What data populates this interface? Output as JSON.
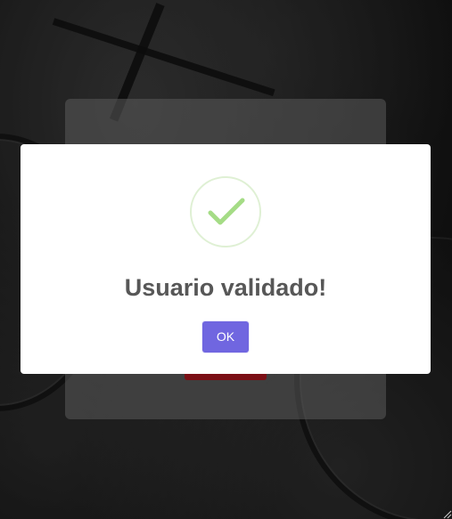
{
  "modal": {
    "title": "Usuario validado!",
    "ok_label": "OK",
    "icon": "checkmark-icon",
    "icon_color": "#a5dc86",
    "button_color": "#7066e0"
  },
  "background": {
    "login_button_color": "#a5141c"
  }
}
